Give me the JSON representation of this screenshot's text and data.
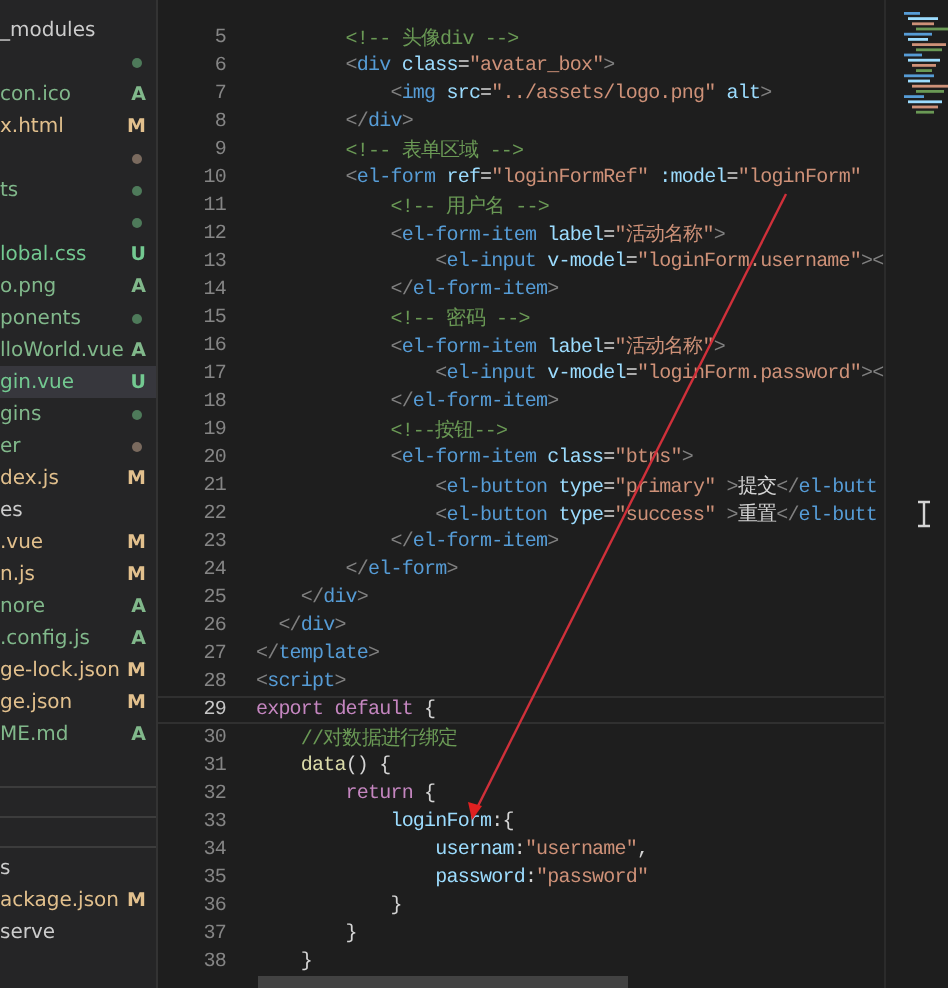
{
  "explorer": {
    "items": [
      {
        "label": "_modules"
      },
      {
        "color": "#4e7a5a"
      },
      {
        "label": "con.ico",
        "status": "A"
      },
      {
        "label": "x.html",
        "status": "M"
      },
      {
        "color": "#7a6a5e"
      },
      {
        "label": "ts",
        "color": "#4e7a5a"
      },
      {
        "color": "#4e7a5a"
      },
      {
        "label": "lobal.css",
        "status": "U"
      },
      {
        "label": "o.png",
        "status": "A"
      },
      {
        "label": "ponents",
        "color": "#4e7a5a"
      },
      {
        "label": "lloWorld.vue",
        "status": "A"
      },
      {
        "label": "gin.vue",
        "status": "U",
        "selected": true
      },
      {
        "label": "gins",
        "color": "#4e7a5a"
      },
      {
        "label": "er",
        "color": "#7a6a5e"
      },
      {
        "label": "dex.js",
        "status": "M"
      },
      {
        "label": "es"
      },
      {
        "label": ".vue",
        "status": "M"
      },
      {
        "label": "n.js",
        "status": "M"
      },
      {
        "label": "nore",
        "status": "A"
      },
      {
        "label": ".config.js",
        "status": "A"
      },
      {
        "label": "ge-lock.json",
        "status": "M"
      },
      {
        "label": "ge.json",
        "status": "M"
      },
      {
        "label": "ME.md",
        "status": "A"
      }
    ],
    "scripts": [
      {
        "label": "s"
      },
      {
        "label": "ackage.json",
        "status": "M"
      },
      {
        "label": "serve"
      }
    ]
  },
  "editor": {
    "lines": [
      {
        "number": "5",
        "tokens": [
          {
            "kind": "c",
            "text": "        <!-- 头像div -->"
          }
        ]
      },
      {
        "number": "6",
        "tokens": [
          {
            "kind": "p",
            "text": "        <"
          },
          {
            "kind": "t",
            "text": "div"
          },
          {
            "kind": "a",
            "text": " class"
          },
          {
            "kind": "x",
            "text": "="
          },
          {
            "kind": "s",
            "text": "\"avatar_box\""
          },
          {
            "kind": "p",
            "text": ">"
          }
        ]
      },
      {
        "number": "7",
        "tokens": [
          {
            "kind": "p",
            "text": "            <"
          },
          {
            "kind": "t",
            "text": "img"
          },
          {
            "kind": "a",
            "text": " src"
          },
          {
            "kind": "x",
            "text": "="
          },
          {
            "kind": "s",
            "text": "\"../assets/logo.png\""
          },
          {
            "kind": "a",
            "text": " alt"
          },
          {
            "kind": "p",
            "text": ">"
          }
        ]
      },
      {
        "number": "8",
        "tokens": [
          {
            "kind": "p",
            "text": "        </"
          },
          {
            "kind": "t",
            "text": "div"
          },
          {
            "kind": "p",
            "text": ">"
          }
        ]
      },
      {
        "number": "9",
        "tokens": [
          {
            "kind": "c",
            "text": "        <!-- 表单区域 -->"
          }
        ]
      },
      {
        "number": "10",
        "tokens": [
          {
            "kind": "p",
            "text": "        <"
          },
          {
            "kind": "t",
            "text": "el-form"
          },
          {
            "kind": "a",
            "text": " ref"
          },
          {
            "kind": "x",
            "text": "="
          },
          {
            "kind": "s",
            "text": "\"loginFormRef\""
          },
          {
            "kind": "a",
            "text": " :model"
          },
          {
            "kind": "x",
            "text": "="
          },
          {
            "kind": "s",
            "text": "\"loginForm\""
          }
        ]
      },
      {
        "number": "11",
        "tokens": [
          {
            "kind": "c",
            "text": "            <!-- 用户名 -->"
          }
        ]
      },
      {
        "number": "12",
        "tokens": [
          {
            "kind": "p",
            "text": "            <"
          },
          {
            "kind": "t",
            "text": "el-form-item"
          },
          {
            "kind": "a",
            "text": " label"
          },
          {
            "kind": "x",
            "text": "="
          },
          {
            "kind": "s",
            "text": "\"活动名称\""
          },
          {
            "kind": "p",
            "text": ">"
          }
        ]
      },
      {
        "number": "13",
        "tokens": [
          {
            "kind": "p",
            "text": "                <"
          },
          {
            "kind": "t",
            "text": "el-input"
          },
          {
            "kind": "a",
            "text": " v-model"
          },
          {
            "kind": "x",
            "text": "="
          },
          {
            "kind": "s",
            "text": "\"loginForm.username\""
          },
          {
            "kind": "p",
            "text": "><"
          }
        ]
      },
      {
        "number": "14",
        "tokens": [
          {
            "kind": "p",
            "text": "            </"
          },
          {
            "kind": "t",
            "text": "el-form-item"
          },
          {
            "kind": "p",
            "text": ">"
          }
        ]
      },
      {
        "number": "15",
        "tokens": [
          {
            "kind": "c",
            "text": "            <!-- 密码 -->"
          }
        ]
      },
      {
        "number": "16",
        "tokens": [
          {
            "kind": "p",
            "text": "            <"
          },
          {
            "kind": "t",
            "text": "el-form-item"
          },
          {
            "kind": "a",
            "text": " label"
          },
          {
            "kind": "x",
            "text": "="
          },
          {
            "kind": "s",
            "text": "\"活动名称\""
          },
          {
            "kind": "p",
            "text": ">"
          }
        ]
      },
      {
        "number": "17",
        "tokens": [
          {
            "kind": "p",
            "text": "                <"
          },
          {
            "kind": "t",
            "text": "el-input"
          },
          {
            "kind": "a",
            "text": " v-model"
          },
          {
            "kind": "x",
            "text": "="
          },
          {
            "kind": "s",
            "text": "\"loginForm.password\""
          },
          {
            "kind": "p",
            "text": "><"
          }
        ]
      },
      {
        "number": "18",
        "tokens": [
          {
            "kind": "p",
            "text": "            </"
          },
          {
            "kind": "t",
            "text": "el-form-item"
          },
          {
            "kind": "p",
            "text": ">"
          }
        ]
      },
      {
        "number": "19",
        "tokens": [
          {
            "kind": "c",
            "text": "            <!--按钮-->"
          }
        ]
      },
      {
        "number": "20",
        "tokens": [
          {
            "kind": "p",
            "text": "            <"
          },
          {
            "kind": "t",
            "text": "el-form-item"
          },
          {
            "kind": "a",
            "text": " class"
          },
          {
            "kind": "x",
            "text": "="
          },
          {
            "kind": "s",
            "text": "\"btns\""
          },
          {
            "kind": "p",
            "text": ">"
          }
        ]
      },
      {
        "number": "21",
        "tokens": [
          {
            "kind": "p",
            "text": "                <"
          },
          {
            "kind": "t",
            "text": "el-button"
          },
          {
            "kind": "a",
            "text": " type"
          },
          {
            "kind": "x",
            "text": "="
          },
          {
            "kind": "s",
            "text": "\"primary\""
          },
          {
            "kind": "p",
            "text": " >"
          },
          {
            "kind": "x",
            "text": "提交"
          },
          {
            "kind": "p",
            "text": "</"
          },
          {
            "kind": "t",
            "text": "el-butt"
          }
        ]
      },
      {
        "number": "22",
        "tokens": [
          {
            "kind": "p",
            "text": "                <"
          },
          {
            "kind": "t",
            "text": "el-button"
          },
          {
            "kind": "a",
            "text": " type"
          },
          {
            "kind": "x",
            "text": "="
          },
          {
            "kind": "s",
            "text": "\"success\""
          },
          {
            "kind": "p",
            "text": " >"
          },
          {
            "kind": "x",
            "text": "重置"
          },
          {
            "kind": "p",
            "text": "</"
          },
          {
            "kind": "t",
            "text": "el-butt"
          }
        ]
      },
      {
        "number": "23",
        "tokens": [
          {
            "kind": "p",
            "text": "            </"
          },
          {
            "kind": "t",
            "text": "el-form-item"
          },
          {
            "kind": "p",
            "text": ">"
          }
        ]
      },
      {
        "number": "24",
        "tokens": [
          {
            "kind": "p",
            "text": "        </"
          },
          {
            "kind": "t",
            "text": "el-form"
          },
          {
            "kind": "p",
            "text": ">"
          }
        ]
      },
      {
        "number": "25",
        "tokens": [
          {
            "kind": "p",
            "text": "    </"
          },
          {
            "kind": "t",
            "text": "div"
          },
          {
            "kind": "p",
            "text": ">"
          }
        ]
      },
      {
        "number": "26",
        "tokens": [
          {
            "kind": "p",
            "text": "  </"
          },
          {
            "kind": "t",
            "text": "div"
          },
          {
            "kind": "p",
            "text": ">"
          }
        ]
      },
      {
        "number": "27",
        "tokens": [
          {
            "kind": "p",
            "text": "</"
          },
          {
            "kind": "t",
            "text": "template"
          },
          {
            "kind": "p",
            "text": ">"
          }
        ]
      },
      {
        "number": "28",
        "tokens": [
          {
            "kind": "p",
            "text": "<"
          },
          {
            "kind": "t",
            "text": "script"
          },
          {
            "kind": "p",
            "text": ">"
          }
        ]
      },
      {
        "number": "29",
        "current": true,
        "tokens": [
          {
            "kind": "k",
            "text": "export default "
          },
          {
            "kind": "x",
            "text": "{"
          }
        ]
      },
      {
        "number": "30",
        "tokens": [
          {
            "kind": "c",
            "text": "    //对数据进行绑定"
          }
        ]
      },
      {
        "number": "31",
        "tokens": [
          {
            "kind": "f",
            "text": "    data"
          },
          {
            "kind": "x",
            "text": "() {"
          }
        ]
      },
      {
        "number": "32",
        "tokens": [
          {
            "kind": "k",
            "text": "        return"
          },
          {
            "kind": "x",
            "text": " {"
          }
        ]
      },
      {
        "number": "33",
        "tokens": [
          {
            "kind": "v",
            "text": "            loginForm"
          },
          {
            "kind": "x",
            "text": ":{"
          }
        ]
      },
      {
        "number": "34",
        "tokens": [
          {
            "kind": "v",
            "text": "                usernam"
          },
          {
            "kind": "x",
            "text": ":"
          },
          {
            "kind": "s",
            "text": "\"username\""
          },
          {
            "kind": "x",
            "text": ","
          }
        ]
      },
      {
        "number": "35",
        "tokens": [
          {
            "kind": "v",
            "text": "                password"
          },
          {
            "kind": "x",
            "text": ":"
          },
          {
            "kind": "s",
            "text": "\"password\""
          }
        ]
      },
      {
        "number": "36",
        "tokens": [
          {
            "kind": "x",
            "text": "            }"
          }
        ]
      },
      {
        "number": "37",
        "tokens": [
          {
            "kind": "x",
            "text": "        }"
          }
        ]
      },
      {
        "number": "38",
        "tokens": [
          {
            "kind": "x",
            "text": "    }"
          }
        ]
      }
    ]
  }
}
